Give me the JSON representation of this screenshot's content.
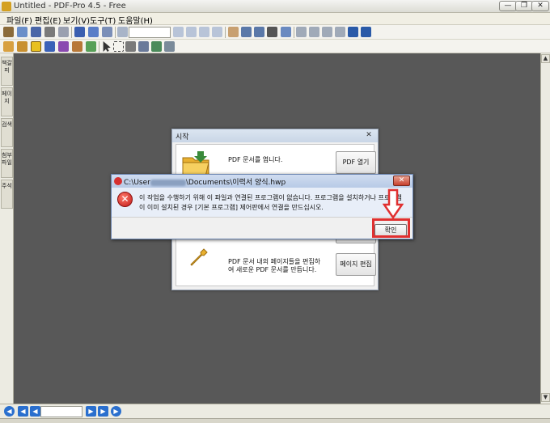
{
  "window": {
    "title": "Untitled - PDF-Pro 4.5 - Free",
    "minimize": "—",
    "restore": "❐",
    "close": "✕"
  },
  "menu": [
    "파일(F)",
    "편집(E)",
    "보기(V)",
    "도구(T)",
    "도움말(H)"
  ],
  "sidebar_tabs": [
    "책갈피",
    "페이지",
    "검색",
    "첨부파일",
    "주석"
  ],
  "start_dialog": {
    "title": "시작",
    "close": "✕",
    "open_text": "PDF 문서를 엽니다.",
    "open_button": "PDF 열기",
    "edit_text_line1": "PDF 문서 내의 페이지들을 편집하",
    "edit_text_line2": "여 새로운 PDF 문서를 만듭니다.",
    "edit_button": "페이지 편집"
  },
  "error_dialog": {
    "title_left": "C:\\User",
    "title_right": "\\Documents\\이력서 양식.hwp",
    "close": "✕",
    "message": "이 작업을 수행하기 위해 이 파일과 연결된 프로그램이 없습니다. 프로그램을 설치하거나 프로그램이 이미 설치된 경우 [기본 프로그램] 제어판에서 연결을 만드십시오.",
    "ok_button": "확인"
  },
  "colors": {
    "highlight": "#e03030",
    "canvas": "#585858",
    "nav_blue": "#2a6fce"
  }
}
